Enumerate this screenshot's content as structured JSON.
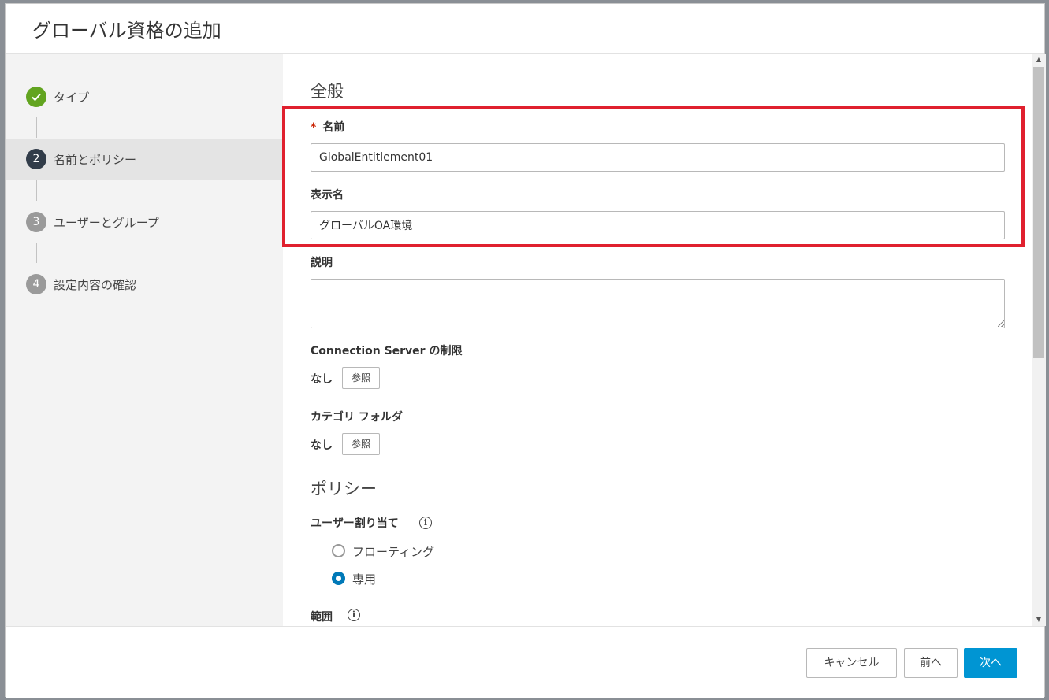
{
  "dialog": {
    "title": "グローバル資格の追加"
  },
  "steps": [
    {
      "num": "",
      "label": "タイプ",
      "state": "done"
    },
    {
      "num": "2",
      "label": "名前とポリシー",
      "state": "active"
    },
    {
      "num": "3",
      "label": "ユーザーとグループ",
      "state": "pending"
    },
    {
      "num": "4",
      "label": "設定内容の確認",
      "state": "pending"
    }
  ],
  "general": {
    "title": "全般",
    "name": {
      "required_mark": "*",
      "label": "名前",
      "value": "GlobalEntitlement01"
    },
    "display_name": {
      "label": "表示名",
      "value": "グローバルOA環境"
    },
    "description": {
      "label": "説明",
      "value": ""
    },
    "connection_server": {
      "label": "Connection Server の制限",
      "value": "なし",
      "browse": "参照"
    },
    "category_folder": {
      "label": "カテゴリ フォルダ",
      "value": "なし",
      "browse": "参照"
    }
  },
  "policy": {
    "title": "ポリシー",
    "user_assignment": {
      "label": "ユーザー割り当て",
      "info": "i",
      "options": [
        {
          "label": "フローティング",
          "checked": false
        },
        {
          "label": "専用",
          "checked": true
        }
      ]
    },
    "scope": {
      "label": "範囲",
      "info": "i"
    }
  },
  "footer": {
    "cancel": "キャンセル",
    "back": "前へ",
    "next": "次へ"
  },
  "colors": {
    "accent": "#0095d3",
    "done": "#62a420",
    "active_step": "#313c49",
    "highlight": "#e0202e"
  }
}
